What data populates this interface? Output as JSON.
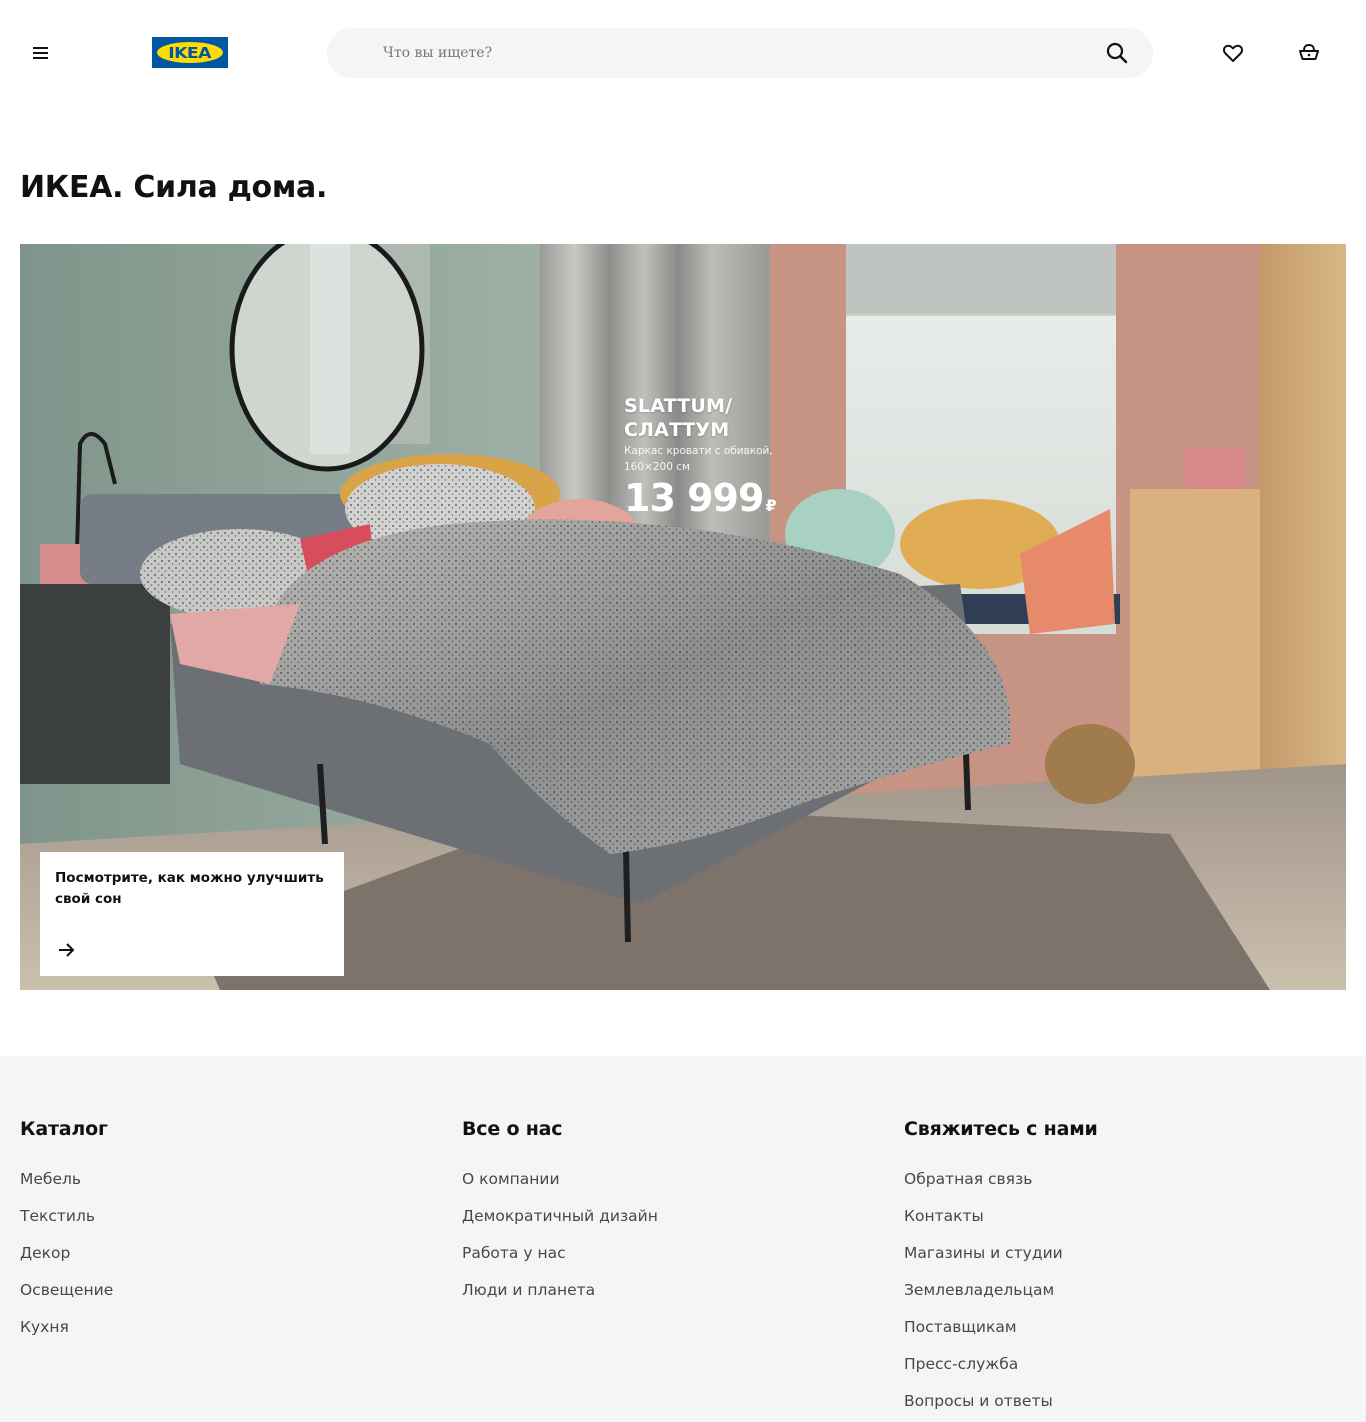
{
  "header": {
    "logo_text": "IKEA",
    "search_placeholder": "Что вы ищете?"
  },
  "page": {
    "title": "ИКЕА. Сила дома."
  },
  "hero": {
    "product_name_line1": "SLATTUM/",
    "product_name_line2": "СЛАТТУМ",
    "product_desc_line1": "Каркас кровати с обивкой,",
    "product_desc_line2": "160×200 см",
    "price": "13 999",
    "currency": "₽",
    "card_text": "Посмотрите, как можно улучшить свой сон"
  },
  "footer": {
    "catalog": {
      "title": "Каталог",
      "links": [
        "Мебель",
        "Текстиль",
        "Декор",
        "Освещение",
        "Кухня"
      ]
    },
    "about": {
      "title": "Все о нас",
      "links": [
        "О компании",
        "Демократичный дизайн",
        "Работа у нас",
        "Люди и планета"
      ]
    },
    "contact": {
      "title": "Свяжитесь с нами",
      "links": [
        "Обратная связь",
        "Контакты",
        "Магазины и студии",
        "Землевладельцам",
        "Поставщикам",
        "Пресс-служба",
        "Вопросы и ответы"
      ]
    }
  },
  "icons": {
    "menu": "menu-icon",
    "search": "search-icon",
    "favourites": "heart-icon",
    "cart": "cart-icon",
    "card_arrow": "arrow-right-icon"
  },
  "colors": {
    "ikea_blue": "#0058a3",
    "ikea_yellow": "#ffdb00",
    "footer_bg": "#f5f5f5"
  }
}
